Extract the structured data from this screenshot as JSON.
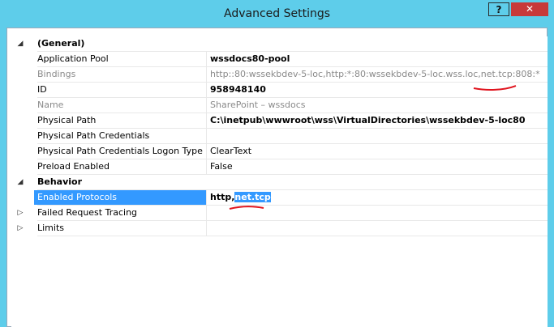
{
  "window": {
    "title": "Advanced Settings",
    "help_label": "?",
    "close_label": "✕"
  },
  "colors": {
    "titlebar": "#5ecdea",
    "close": "#c7393a",
    "selection": "#3399ff",
    "annotation": "#e0141e"
  },
  "categories": {
    "general": {
      "expander": "◢",
      "label": "(General)"
    },
    "behavior": {
      "expander": "◢",
      "label": "Behavior"
    },
    "failed_request_tracing": {
      "expander": "▷",
      "label": "Failed Request Tracing"
    },
    "limits": {
      "expander": "▷",
      "label": "Limits"
    }
  },
  "properties": {
    "application_pool": {
      "name": "Application Pool",
      "value": "wssdocs80-pool"
    },
    "bindings": {
      "name": "Bindings",
      "value": "http::80:wssekbdev-5-loc,http:*:80:wssekbdev-5-loc.wss.loc,net.tcp:808:*"
    },
    "id": {
      "name": "ID",
      "value": "958948140"
    },
    "name": {
      "name": "Name",
      "value": "SharePoint – wssdocs"
    },
    "physical_path": {
      "name": "Physical Path",
      "value": "C:\\inetpub\\wwwroot\\wss\\VirtualDirectories\\wssekbdev-5-loc80"
    },
    "physical_path_credentials": {
      "name": "Physical Path Credentials",
      "value": ""
    },
    "logon_type": {
      "name": "Physical Path Credentials Logon Type",
      "value": "ClearText"
    },
    "preload_enabled": {
      "name": "Preload Enabled",
      "value": "False"
    },
    "enabled_protocols": {
      "name": "Enabled Protocols",
      "value_prefix": "http,",
      "value_selected": "net.tcp"
    }
  }
}
